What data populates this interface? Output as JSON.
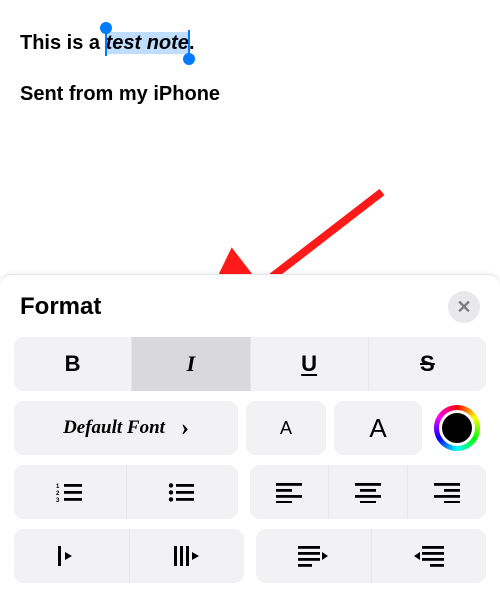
{
  "content": {
    "line1_before": "This is a ",
    "line1_selected": "test note",
    "line1_after": ".",
    "line2": "Sent from my iPhone"
  },
  "panel": {
    "title": "Format",
    "close_glyph": "✕",
    "bold_label": "B",
    "italic_label": "I",
    "underline_label": "U",
    "strike_label": "S",
    "font_label": "Default Font",
    "chevron": "›",
    "size_small": "A",
    "size_large": "A"
  },
  "colors": {
    "accent": "#007aff",
    "annotation": "#ff1a1a"
  }
}
